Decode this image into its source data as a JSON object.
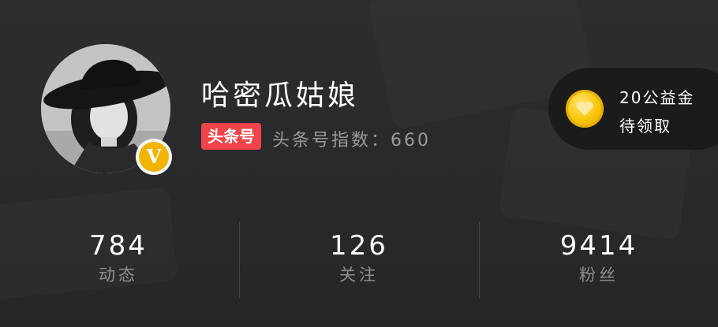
{
  "profile": {
    "nickname": "哈密瓜姑娘",
    "verified_badge": "V",
    "tag_label": "头条号",
    "index_text": "头条号指数：660"
  },
  "charity": {
    "line1": "20公益金",
    "line2": "待领取",
    "icon": "heart-coin-icon"
  },
  "stats": [
    {
      "value": "784",
      "label": "动态"
    },
    {
      "value": "126",
      "label": "关注"
    },
    {
      "value": "9414",
      "label": "粉丝"
    }
  ],
  "colors": {
    "background": "#2b2b2d",
    "tag_red": "#f0434a",
    "badge_gold": "#f2b400",
    "coin_gold": "#f8c400",
    "pill_dark": "#1b1b1c"
  }
}
